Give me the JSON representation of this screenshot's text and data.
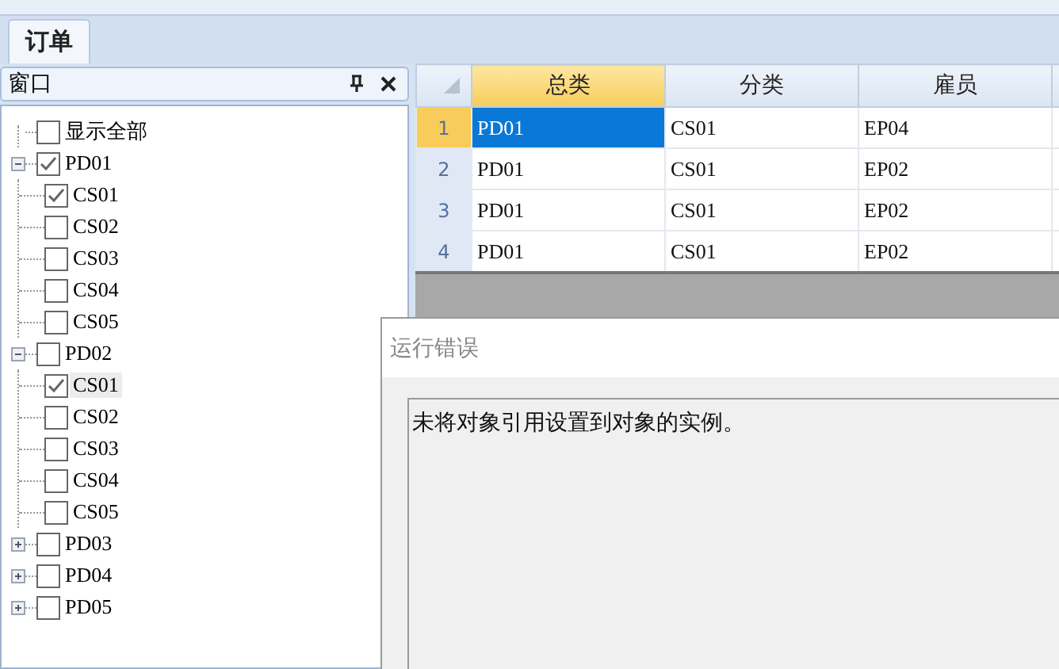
{
  "tabs": [
    {
      "label": "订单",
      "selected": true
    }
  ],
  "panel": {
    "title": "窗口",
    "tree": [
      {
        "label": "显示全部",
        "checked": false,
        "selected": false
      },
      {
        "label": "PD01",
        "checked": true,
        "expanded": true,
        "selected": false,
        "children": [
          {
            "label": "CS01",
            "checked": true,
            "selected": false
          },
          {
            "label": "CS02",
            "checked": false,
            "selected": false
          },
          {
            "label": "CS03",
            "checked": false,
            "selected": false
          },
          {
            "label": "CS04",
            "checked": false,
            "selected": false
          },
          {
            "label": "CS05",
            "checked": false,
            "selected": false
          }
        ]
      },
      {
        "label": "PD02",
        "checked": false,
        "expanded": true,
        "selected": false,
        "children": [
          {
            "label": "CS01",
            "checked": true,
            "selected": true
          },
          {
            "label": "CS02",
            "checked": false,
            "selected": false
          },
          {
            "label": "CS03",
            "checked": false,
            "selected": false
          },
          {
            "label": "CS04",
            "checked": false,
            "selected": false
          },
          {
            "label": "CS05",
            "checked": false,
            "selected": false
          }
        ]
      },
      {
        "label": "PD03",
        "checked": false,
        "expanded": false,
        "selected": false
      },
      {
        "label": "PD04",
        "checked": false,
        "expanded": false,
        "selected": false
      },
      {
        "label": "PD05",
        "checked": false,
        "expanded": false,
        "selected": false
      }
    ]
  },
  "table": {
    "columns": [
      {
        "label": "总类",
        "selected": true
      },
      {
        "label": "分类",
        "selected": false
      },
      {
        "label": "雇员",
        "selected": false
      }
    ],
    "rows": [
      {
        "number": "1",
        "selected": true,
        "cells": [
          "PD01",
          "CS01",
          "EP04"
        ]
      },
      {
        "number": "2",
        "selected": false,
        "cells": [
          "PD01",
          "CS01",
          "EP02"
        ]
      },
      {
        "number": "3",
        "selected": false,
        "cells": [
          "PD01",
          "CS01",
          "EP02"
        ]
      },
      {
        "number": "4",
        "selected": false,
        "cells": [
          "PD01",
          "CS01",
          "EP02"
        ]
      }
    ]
  },
  "dialog": {
    "title": "运行错误",
    "message": "未将对象引用设置到对象的实例。"
  }
}
